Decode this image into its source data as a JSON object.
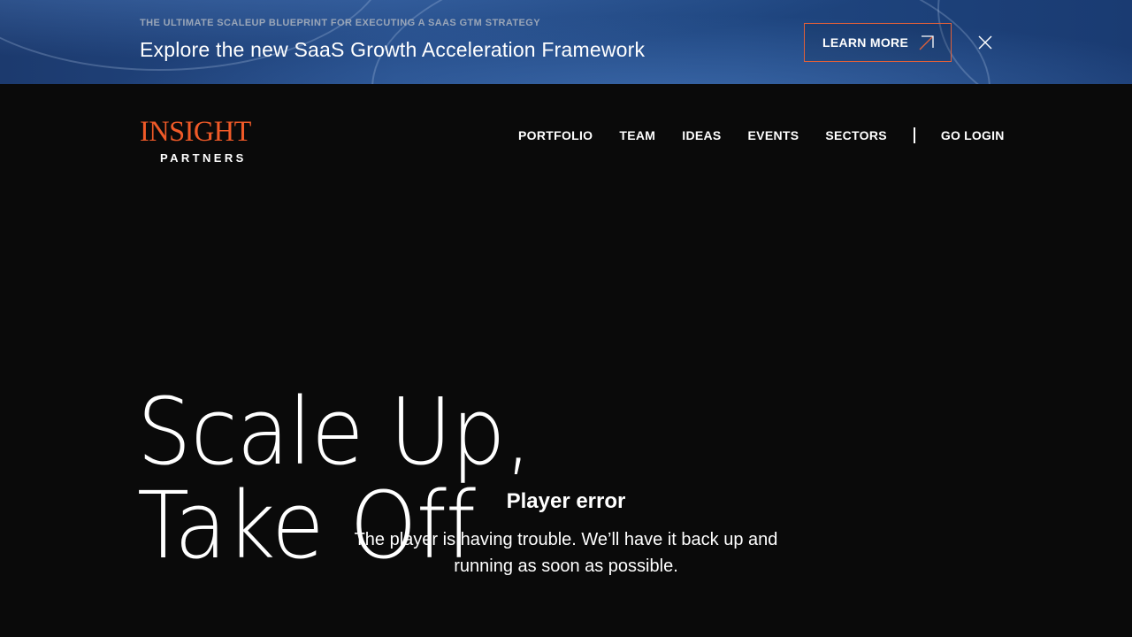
{
  "banner": {
    "eyebrow": "THE ULTIMATE SCALEUP BLUEPRINT FOR EXECUTING A SAAS GTM STRATEGY",
    "title": "Explore the new SaaS Growth Acceleration Framework",
    "cta_label": "LEARN MORE",
    "cta_icon": "arrow-up-right-icon",
    "close_icon": "close-icon"
  },
  "header": {
    "logo_main": "INSIGHT",
    "logo_sub": "PARTNERS",
    "nav": [
      {
        "label": "PORTFOLIO"
      },
      {
        "label": "TEAM"
      },
      {
        "label": "IDEAS"
      },
      {
        "label": "EVENTS"
      },
      {
        "label": "SECTORS"
      }
    ],
    "login_label": "GO LOGIN"
  },
  "hero": {
    "line1": "Scale Up,",
    "line2": "Take Off"
  },
  "player": {
    "error_title": "Player error",
    "error_message": "The player is having trouble. We’ll have it back up and running as soon as possible."
  },
  "colors": {
    "brand_orange": "#f05a28",
    "background": "#0a0a0a",
    "banner_blue": "#234a86"
  }
}
